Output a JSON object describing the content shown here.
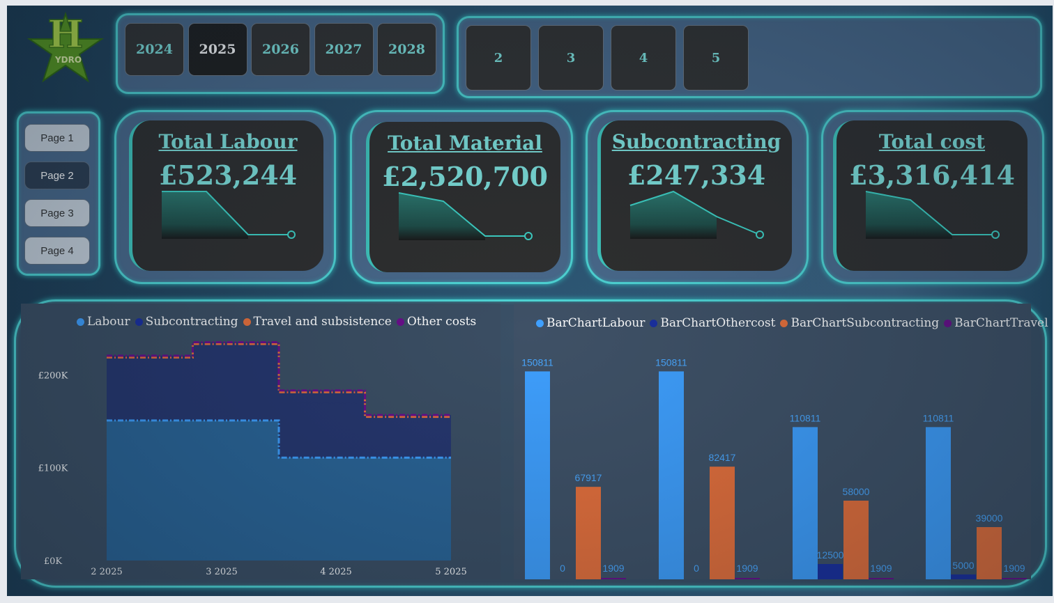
{
  "logo": {
    "letter": "H",
    "text": "YDRO"
  },
  "years": [
    "2024",
    "2025",
    "2026",
    "2027",
    "2028"
  ],
  "selected_year": "2025",
  "months": [
    "2",
    "3",
    "4",
    "5"
  ],
  "pages": [
    "Page 1",
    "Page 2",
    "Page 3",
    "Page 4"
  ],
  "selected_page": "Page 2",
  "kpis": [
    {
      "title": "Total Labour",
      "value": "£523,244",
      "trend": [
        151,
        151,
        111,
        111
      ]
    },
    {
      "title": "Total Material",
      "value": "£2,520,700",
      "trend": [
        260,
        250,
        220,
        220
      ]
    },
    {
      "title": "Subcontracting",
      "value": "£247,334",
      "trend": [
        60,
        82,
        58,
        39
      ]
    },
    {
      "title": "Total cost",
      "value": "£3,316,414",
      "trend": [
        220,
        210,
        180,
        180
      ]
    }
  ],
  "colors": {
    "accent": "#4fd6d6",
    "labour": "#3fa0ff",
    "subcontracting": "#1a2fa0",
    "travel": "#e8703a",
    "other": "#6a0e8a",
    "kpi_text": "#7fe3de"
  },
  "chart_data": [
    {
      "type": "area",
      "step": true,
      "stacked": true,
      "categories": [
        "2 2025",
        "3 2025",
        "4 2025",
        "5 2025"
      ],
      "yticks": [
        "£0K",
        "£100K",
        "£200K"
      ],
      "ylim": [
        0,
        240000
      ],
      "legend_position": "top",
      "series": [
        {
          "name": "Labour",
          "values": [
            150811,
            150811,
            110811,
            110811
          ]
        },
        {
          "name": "Subcontracting",
          "values": [
            67917,
            82417,
            58000,
            39000
          ]
        },
        {
          "name": "Travel and subsistence",
          "values": [
            0,
            0,
            12500,
            5000
          ]
        },
        {
          "name": "Other costs",
          "values": [
            1909,
            1909,
            1909,
            1909
          ]
        }
      ]
    },
    {
      "type": "bar",
      "categories": [
        "2 2025",
        "3 2025",
        "4 2025",
        "5 2025"
      ],
      "ylim": [
        0,
        160000
      ],
      "legend_position": "top",
      "series": [
        {
          "name": "BarChartLabour",
          "values": [
            150811,
            150811,
            110811,
            110811
          ],
          "labels": [
            "150811",
            "150811",
            "110811",
            "110811"
          ]
        },
        {
          "name": "BarChartOthercost",
          "values": [
            0,
            0,
            12500,
            5000
          ],
          "labels": [
            "0",
            "0",
            "12500",
            "5000"
          ]
        },
        {
          "name": "BarChartSubcontracting",
          "values": [
            67917,
            82417,
            58000,
            39000
          ],
          "labels": [
            "67917",
            "82417",
            "58000",
            "39000"
          ]
        },
        {
          "name": "BarChartTravel",
          "values": [
            1909,
            1909,
            1909,
            1909
          ],
          "labels": [
            "1909",
            "1909",
            "1909",
            "1909"
          ]
        }
      ]
    }
  ]
}
